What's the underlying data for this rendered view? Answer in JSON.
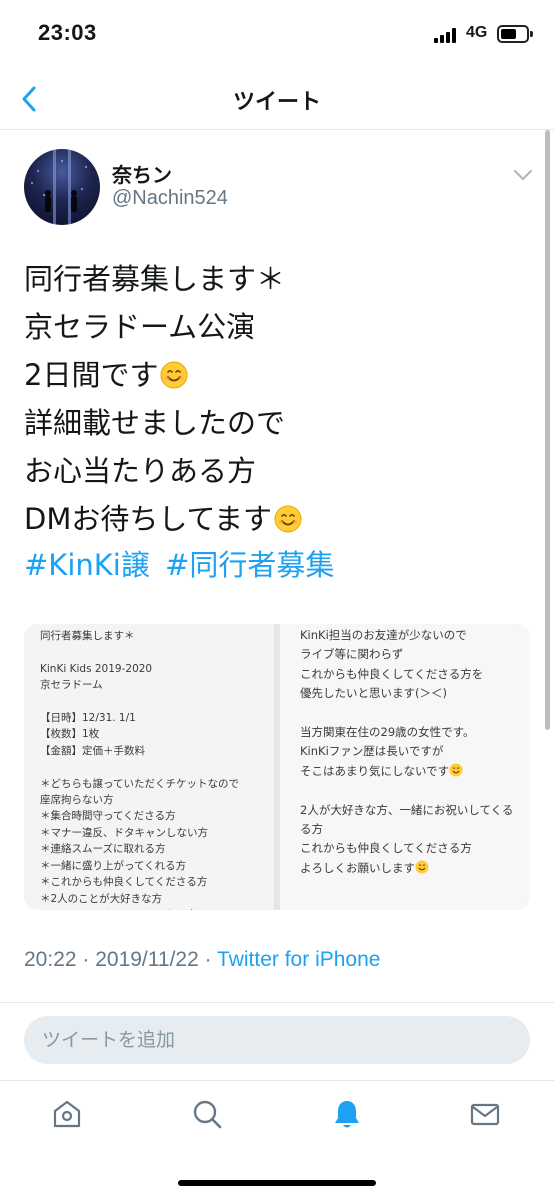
{
  "status_bar": {
    "time": "23:03",
    "network": "4G"
  },
  "nav": {
    "title": "ツイート",
    "back_icon": "chevron-left-icon"
  },
  "tweet": {
    "user_name": "奈ちン",
    "handle": "@Nachin524",
    "text_lines": [
      "同行者募集します＊",
      "京セラドーム公演",
      "2日間です",
      "詳細載せましたので",
      "お心当たりある方",
      "DMお待ちしてます"
    ],
    "hashtags": [
      "#KinKi譲",
      "#同行者募集"
    ],
    "media": {
      "left_text": "同行者募集します＊\n\nKinKi Kids 2019-2020\n京セラドーム\n\n【日時】12/31. 1/1\n【枚数】1枚\n【金額】定価＋手数料\n\n＊どちらも譲っていただくチケットなので\n座席拘らない方\n＊集合時間守ってくださる方\n＊マナー違反、ドタキャンしない方\n＊連絡スムーズに取れる方\n＊一緒に盛り上がってくれる方\n＊これからも仲良くしてくださる方\n＊2人のことが大好きな方\n＊アンリー、オンリーじゃない方",
      "right_text_lines": [
        "KinKi担当のお友達が少ないので",
        "ライブ等に関わらず",
        "これからも仲良くしてくださる方を",
        "優先したいと思います(＞＜)",
        "",
        "当方関東在住の29歳の女性です。",
        "KinKiファン歴は長いですが",
        "そこはあまり気にしないです",
        "",
        "2人が大好きな方、一緒にお祝いしてくる",
        "る方",
        "これからも仲良くしてくださる方",
        "よろしくお願いします"
      ]
    },
    "timestamp": "20:22 · 2019/11/22 · ",
    "source": "Twitter for iPhone"
  },
  "reply": {
    "placeholder": "ツイートを追加"
  },
  "tabs": [
    {
      "name": "home",
      "icon": "home-icon",
      "active": false
    },
    {
      "name": "search",
      "icon": "search-icon",
      "active": false
    },
    {
      "name": "notifications",
      "icon": "bell-icon",
      "active": true
    },
    {
      "name": "messages",
      "icon": "mail-icon",
      "active": false
    }
  ],
  "colors": {
    "accent": "#1da1f2",
    "secondary_text": "#657786",
    "border": "#e1e8ed",
    "inactive_icon": "#657786"
  }
}
